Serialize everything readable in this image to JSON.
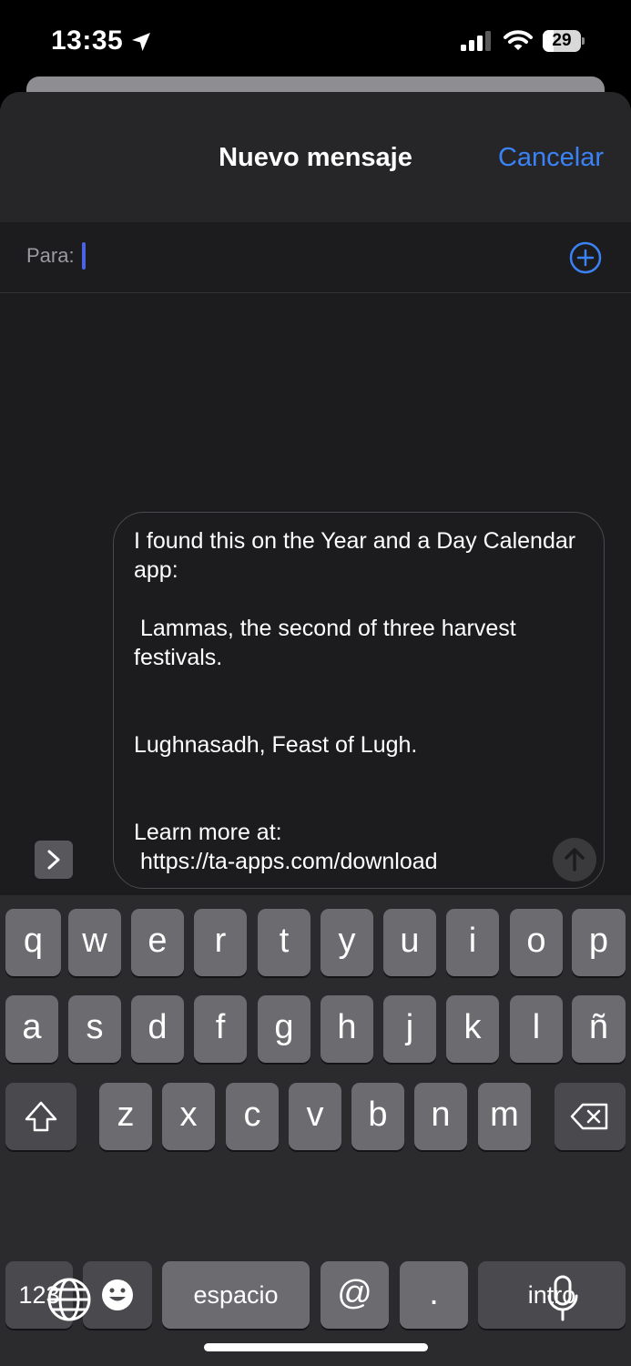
{
  "status": {
    "time": "13:35",
    "battery": "29"
  },
  "header": {
    "title": "Nuevo mensaje",
    "cancel_label": "Cancelar"
  },
  "to_field": {
    "label": "Para:"
  },
  "message": {
    "text": "I found this on the Year and a Day Calendar app:\n\n Lammas, the second of three harvest festivals.\n\n\nLughnasadh, Feast of Lugh.\n\n\nLearn more at:\n https://ta-apps.com/download"
  },
  "keyboard": {
    "row1": [
      "q",
      "w",
      "e",
      "r",
      "t",
      "y",
      "u",
      "i",
      "o",
      "p"
    ],
    "row2": [
      "a",
      "s",
      "d",
      "f",
      "g",
      "h",
      "j",
      "k",
      "l",
      "ñ"
    ],
    "row3": [
      "z",
      "x",
      "c",
      "v",
      "b",
      "n",
      "m"
    ],
    "numbers_label": "123",
    "space_label": "espacio",
    "at_label": "@",
    "dot_label": ".",
    "return_label": "intro"
  }
}
